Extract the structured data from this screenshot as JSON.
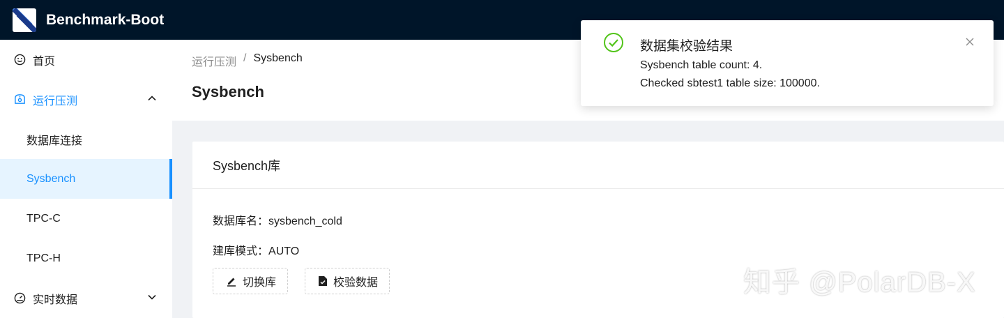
{
  "app": {
    "title": "Benchmark-Boot"
  },
  "sidebar": {
    "items": [
      {
        "label": "首页",
        "icon": "smile-icon"
      },
      {
        "label": "运行压测",
        "icon": "dashboard-icon",
        "expanded": true,
        "children": [
          {
            "label": "数据库连接"
          },
          {
            "label": "Sysbench",
            "selected": true
          },
          {
            "label": "TPC-C"
          },
          {
            "label": "TPC-H"
          }
        ]
      },
      {
        "label": "实时数据",
        "icon": "gauge-icon",
        "expanded": false
      }
    ]
  },
  "breadcrumb": {
    "parent": "运行压测",
    "separator": "/",
    "current": "Sysbench"
  },
  "page": {
    "title": "Sysbench"
  },
  "card": {
    "title": "Sysbench库",
    "db_name_label": "数据库名：",
    "db_name_value": "sysbench_cold",
    "mode_label": "建库模式：",
    "mode_value": "AUTO",
    "switch_button": "切换库",
    "verify_button": "校验数据"
  },
  "notification": {
    "title": "数据集校验结果",
    "line1": "Sysbench table count: 4.",
    "line2": "Checked sbtest1 table size: 100000.",
    "status_color": "#52c41a"
  },
  "watermark": {
    "text": "知乎 @PolarDB-X"
  },
  "colors": {
    "header_bg": "#001529",
    "accent": "#1890ff",
    "selected_bg": "#e6f4ff"
  }
}
